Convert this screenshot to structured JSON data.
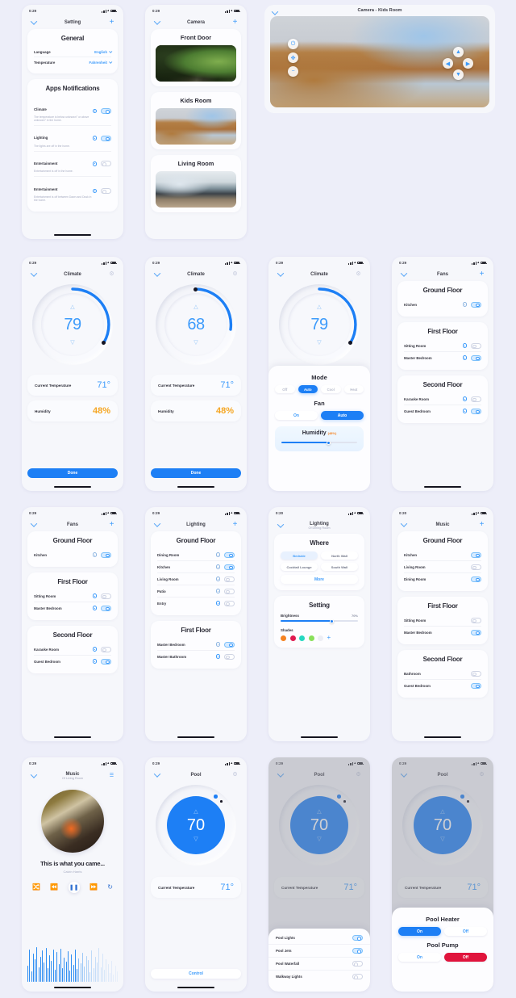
{
  "statusbar": {
    "time": "0:29",
    "time_alt": "0:20"
  },
  "screens": {
    "setting": {
      "title": "Setting",
      "general": {
        "heading": "General",
        "rows": [
          {
            "label": "Language",
            "value": "English"
          },
          {
            "label": "Temperature",
            "value": "Fahrenheit"
          }
        ]
      },
      "notifications": {
        "heading": "Apps Notifications",
        "rows": [
          {
            "label": "Climate",
            "sub": "The temperature is below unknown° or above unknown° in the home.",
            "on": true
          },
          {
            "label": "Lighting",
            "sub": "The lights are off in the home.",
            "on": true
          },
          {
            "label": "Entertainment",
            "sub": "Entertainment is off in the home.",
            "on": false
          },
          {
            "label": "Entertainment",
            "sub": "Entertainment is off between Dawn and Dusk in the home.",
            "on": false
          }
        ]
      }
    },
    "camera_list": {
      "title": "Camera",
      "cameras": [
        {
          "name": "Front Door",
          "scene": "ph-frontdoor"
        },
        {
          "name": "Kids Room",
          "scene": "ph-kids"
        },
        {
          "name": "Living Room",
          "scene": "ph-living"
        }
      ]
    },
    "camera_detail": {
      "title": "Camera - Kids Room",
      "controls": [
        "power-icon",
        "move-icon",
        "minus-icon",
        "left-icon",
        "right-icon",
        "up-icon"
      ]
    },
    "climate_a": {
      "title": "Climate",
      "target": "79",
      "current_label": "Current Temperature",
      "current_value": "71°",
      "humidity_label": "Humidity",
      "humidity_value": "48%",
      "done_label": "Done"
    },
    "climate_b": {
      "title": "Climate",
      "target": "68",
      "current_label": "Current Temperature",
      "current_value": "71°",
      "humidity_label": "Humidity",
      "humidity_value": "48%",
      "done_label": "Done"
    },
    "climate_modes": {
      "title": "Climate",
      "target": "79",
      "mode_heading": "Mode",
      "modes": [
        "Off",
        "Auto",
        "Cool",
        "Heat"
      ],
      "mode_active": "Auto",
      "fan_heading": "Fan",
      "fan_options": [
        "On",
        "Auto"
      ],
      "fan_active": "Auto",
      "humidity_heading": "Humidity",
      "humidity_value": "(48%)",
      "humidity_percent": 48
    },
    "fans": {
      "title": "Fans",
      "groups": [
        {
          "heading": "Ground Floor",
          "rows": [
            {
              "label": "Kitchen",
              "on": true
            }
          ]
        },
        {
          "heading": "First Floor",
          "rows": [
            {
              "label": "Sitting Room",
              "on": false
            },
            {
              "label": "Master Bedroom",
              "on": true
            }
          ]
        },
        {
          "heading": "Second Floor",
          "rows": [
            {
              "label": "Karaoke Room",
              "on": false
            },
            {
              "label": "Guest Bedroom",
              "on": true
            }
          ]
        }
      ]
    },
    "lighting": {
      "title": "Lighting",
      "groups": [
        {
          "heading": "Ground Floor",
          "rows": [
            {
              "label": "Dining Room",
              "on": true
            },
            {
              "label": "Kitchen",
              "on": true
            },
            {
              "label": "Living Room",
              "on": false
            },
            {
              "label": "Patio",
              "on": false
            },
            {
              "label": "Entry",
              "on": false
            }
          ]
        },
        {
          "heading": "First Floor",
          "rows": [
            {
              "label": "Master Bedroom",
              "on": true
            },
            {
              "label": "Master Bathroom",
              "on": false
            }
          ]
        }
      ]
    },
    "lighting_detail": {
      "title": "Lighting",
      "subtitle": "Of  Dining Room",
      "where_heading": "Where",
      "where_options": [
        {
          "label": "Bedside",
          "selected": true
        },
        {
          "label": "North Wall",
          "selected": false
        },
        {
          "label": "Cocktail Lounge",
          "selected": false
        },
        {
          "label": "South Wall",
          "selected": false
        }
      ],
      "more_label": "More",
      "setting_heading": "Setting",
      "brightness_label": "Brightness",
      "brightness_value": "70%",
      "brightness_percent": 70,
      "shades_label": "Shades",
      "shades": [
        "#f58220",
        "#e01a4f",
        "#25d8c0",
        "#89e05a",
        "#edeef5"
      ]
    },
    "music_rooms": {
      "title": "Music",
      "groups": [
        {
          "heading": "Ground Floor",
          "rows": [
            {
              "label": "Kitchen",
              "on": true
            },
            {
              "label": "Living Room",
              "on": false
            },
            {
              "label": "Dining Room",
              "on": true
            }
          ]
        },
        {
          "heading": "First Floor",
          "rows": [
            {
              "label": "Sitting Room",
              "on": false
            },
            {
              "label": "Master Bedroom",
              "on": true
            }
          ]
        },
        {
          "heading": "Second Floor",
          "rows": [
            {
              "label": "Bathroom",
              "on": false
            },
            {
              "label": "Guest Bedroom",
              "on": true
            }
          ]
        }
      ]
    },
    "music_player": {
      "title": "Music",
      "subtitle": "Of  Living Room",
      "track": "This is what you came...",
      "artist": "Calvin Harris",
      "controls": [
        "shuffle-icon",
        "previous-icon",
        "pause-icon",
        "next-icon",
        "repeat-icon"
      ],
      "equalizer": [
        22,
        44,
        14,
        38,
        30,
        47,
        20,
        34,
        42,
        26,
        46,
        18,
        36,
        28,
        43,
        16,
        40,
        24,
        45,
        19,
        33,
        27,
        41,
        15,
        37,
        23,
        44,
        17,
        31,
        25,
        39,
        21,
        35,
        29,
        13,
        42,
        18,
        34,
        26,
        46,
        20,
        38,
        16,
        30,
        24,
        12,
        28,
        10,
        22,
        14
      ]
    },
    "pool_a": {
      "title": "Pool",
      "target": "70",
      "current_label": "Current Temperature",
      "current_value": "71°",
      "control_label": "Control"
    },
    "pool_lights": {
      "title": "Pool",
      "target": "70",
      "current_label": "Current Temperature",
      "current_value": "71°",
      "rows": [
        {
          "label": "Pool Lights",
          "on": true
        },
        {
          "label": "Pool Jets",
          "on": true
        },
        {
          "label": "Pool Waterfall",
          "on": false
        },
        {
          "label": "Walkway Lights",
          "on": false
        }
      ]
    },
    "pool_heater": {
      "title": "Pool",
      "target": "70",
      "current_label": "Current Temperature",
      "current_value": "71°",
      "heater_heading": "Pool Heater",
      "heater_options": [
        "On",
        "Off"
      ],
      "heater_active": "On",
      "pump_heading": "Pool Pump",
      "pump_options": [
        "On",
        "Off"
      ],
      "pump_active": "Off"
    }
  },
  "colors": {
    "accent": "#1d7ff5",
    "accent_light": "#3d9bfb",
    "warm": "#f5a623",
    "danger": "#e0143c",
    "page_bg": "#edeef9"
  }
}
